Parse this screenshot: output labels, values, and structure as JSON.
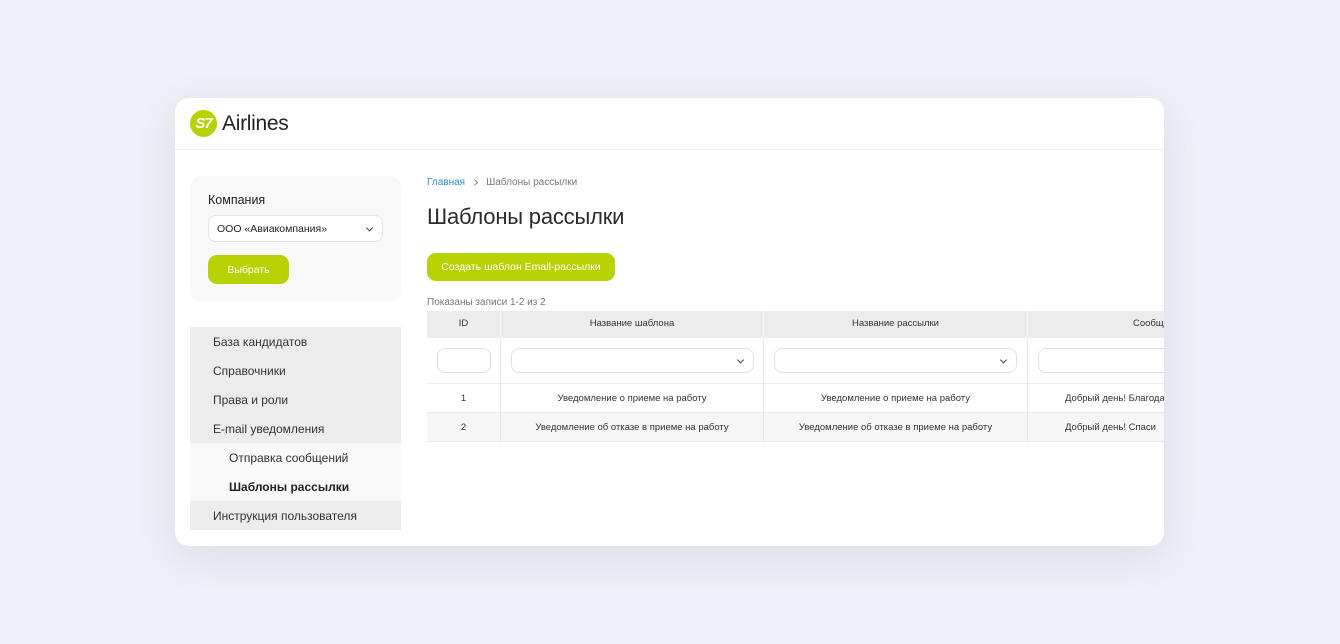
{
  "brand": {
    "logo_mark": "S7",
    "name": "Airlines",
    "color": "#b8d200"
  },
  "company": {
    "label": "Компания",
    "selected": "ООО «Авиакомпания»",
    "choose_label": "Выбрать"
  },
  "nav": {
    "items": [
      {
        "label": "База кандидатов"
      },
      {
        "label": "Справочники"
      },
      {
        "label": "Права и роли"
      },
      {
        "label": "E-mail уведомления"
      },
      {
        "label": "Отправка сообщений"
      },
      {
        "label": "Шаблоны рассылки"
      },
      {
        "label": "Инструкция пользователя"
      }
    ]
  },
  "breadcrumb": {
    "home": "Главная",
    "current": "Шаблоны рассылки"
  },
  "page": {
    "title": "Шаблоны рассылки",
    "create_label": "Создать шаблон Email-рассылки",
    "records_text": "Показаны записи 1-2 из 2"
  },
  "table": {
    "headers": [
      "ID",
      "Название шаблона",
      "Название рассылки",
      "Сообщ"
    ],
    "rows": [
      [
        "1",
        "Уведомление о приеме на работу",
        "Уведомление о приеме на работу",
        "Добрый день! Благода"
      ],
      [
        "2",
        "Уведомление об отказе в приеме на работу",
        "Уведомление об отказе в приеме на работу",
        "Добрый день! Спаси"
      ]
    ]
  },
  "icons": {
    "select_arrow": "chevron-down-icon",
    "breadcrumb_separator": "chevron-right-icon"
  }
}
